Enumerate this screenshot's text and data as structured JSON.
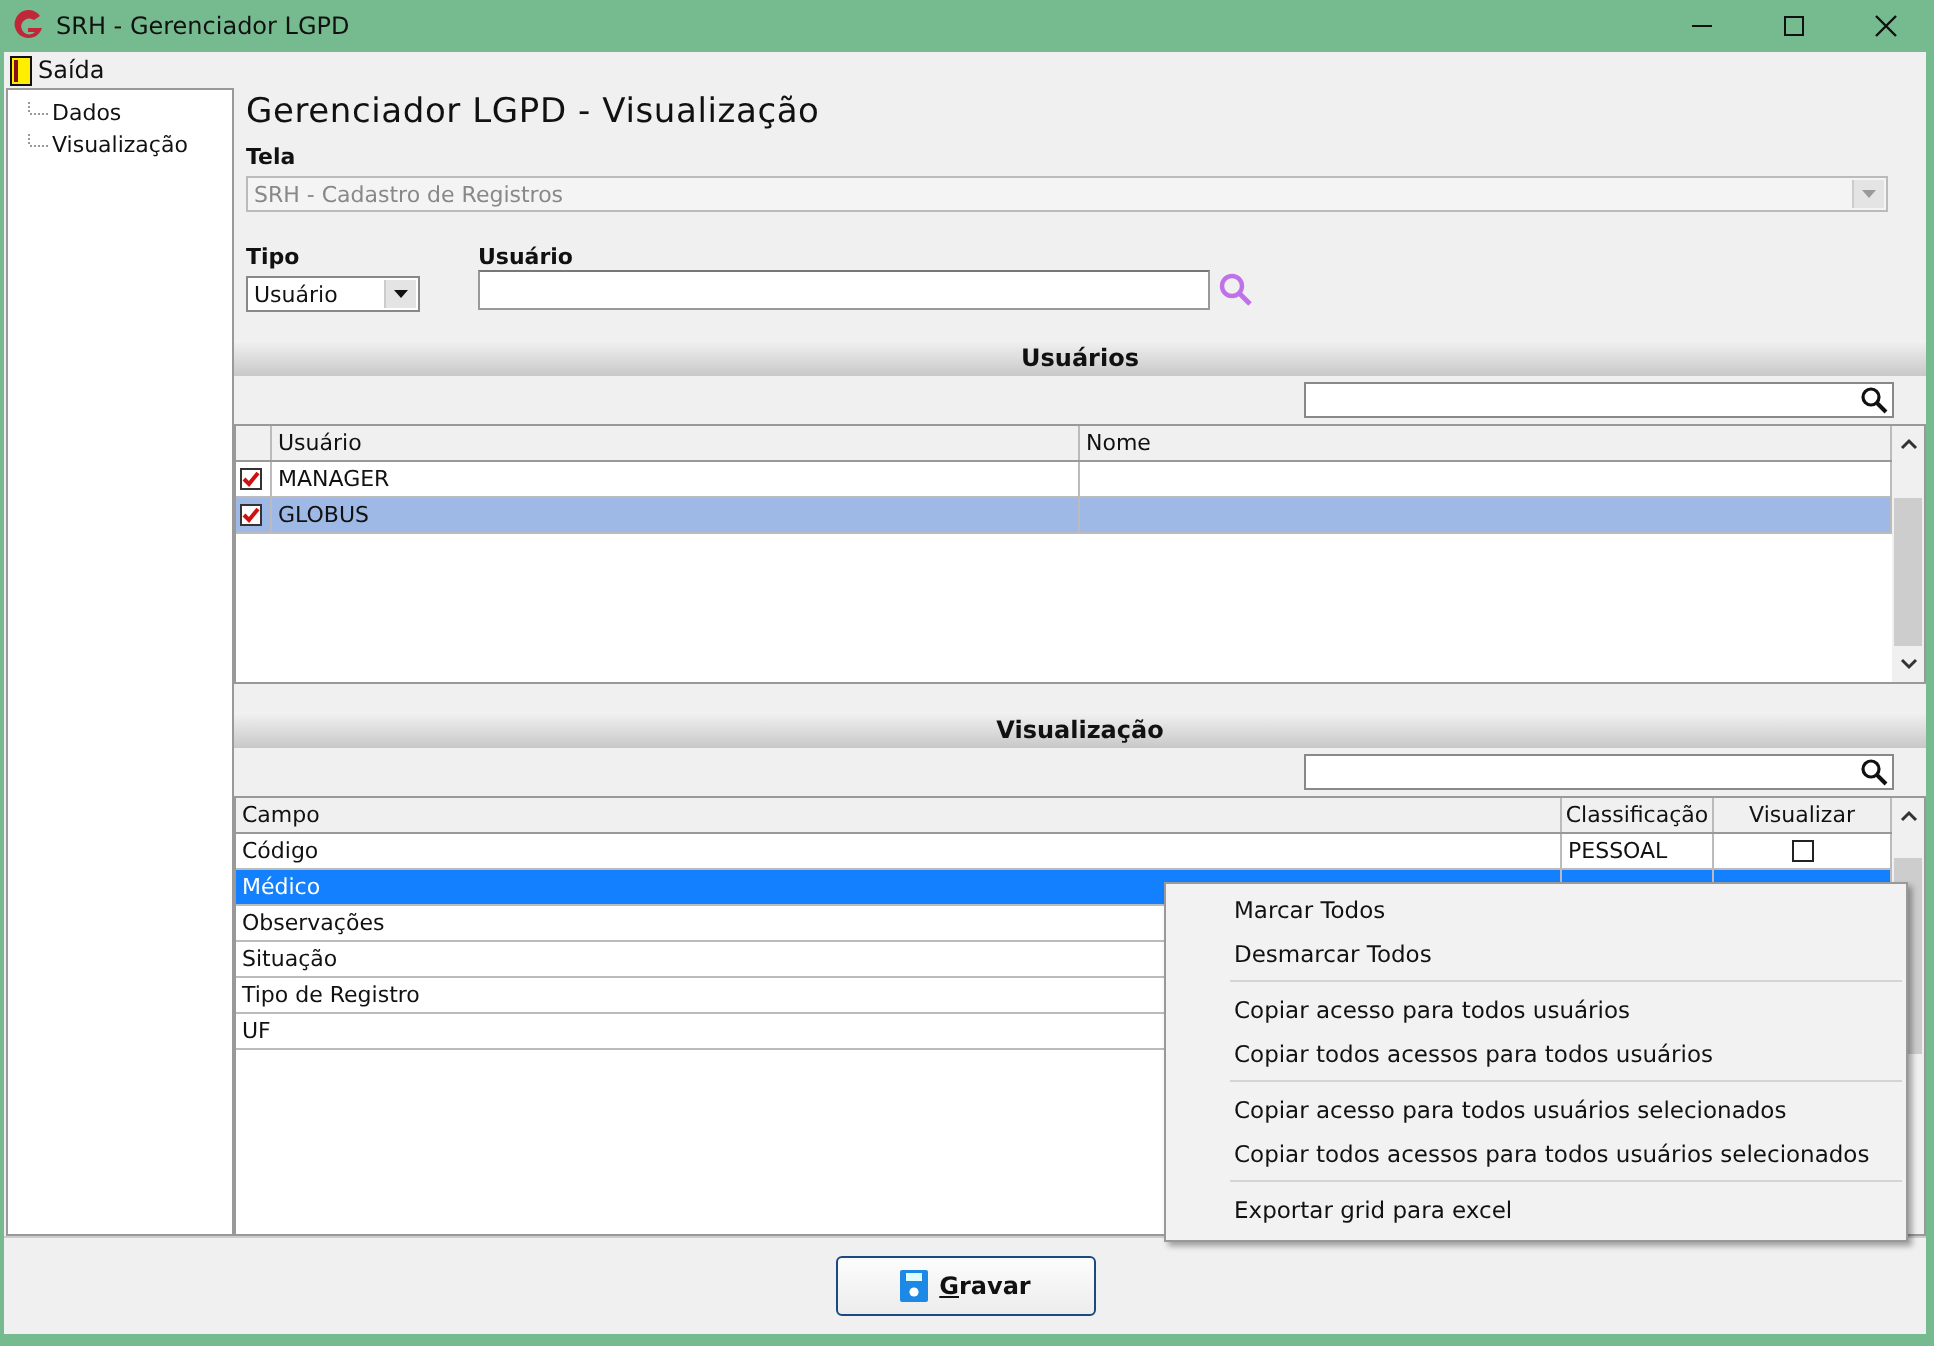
{
  "window": {
    "title": "SRH - Gerenciador LGPD"
  },
  "menu": [
    {
      "label": "Saída"
    }
  ],
  "tree": [
    {
      "label": "Dados"
    },
    {
      "label": "Visualização"
    }
  ],
  "heading": "Gerenciador LGPD - Visualização",
  "tela": {
    "label": "Tela",
    "value": "SRH - Cadastro de Registros",
    "disabled": true
  },
  "tipo": {
    "label": "Tipo",
    "value": "Usuário"
  },
  "usuario": {
    "label": "Usuário"
  },
  "users_section": {
    "title": "Usuários",
    "columns": [
      "Usuário",
      "Nome"
    ],
    "rows": [
      {
        "usuario": "MANAGER",
        "checked": true,
        "selected": false
      },
      {
        "usuario": "GLOBUS",
        "checked": true,
        "selected": true
      }
    ]
  },
  "view_section": {
    "title": "Visualização",
    "columns": [
      "Campo",
      "Classificação",
      "Visualizar"
    ],
    "rows": [
      {
        "campo": "Código",
        "classificacao": "PESSOAL",
        "visualizar": false,
        "selected": false
      },
      {
        "campo": "Médico",
        "selected": true
      },
      {
        "campo": "Observações",
        "selected": false
      },
      {
        "campo": "Situação",
        "selected": false
      },
      {
        "campo": "Tipo de Registro",
        "selected": false
      },
      {
        "campo": "UF",
        "selected": false
      }
    ]
  },
  "context_menu": {
    "groups": [
      [
        "Marcar Todos",
        "Desmarcar Todos"
      ],
      [
        "Copiar acesso para todos usuários",
        "Copiar todos acessos para todos usuários"
      ],
      [
        "Copiar acesso para todos usuários selecionados",
        "Copiar todos acessos para todos usuários selecionados"
      ],
      [
        "Exportar grid para excel"
      ]
    ]
  },
  "save_button": {
    "label": "Gravar"
  }
}
